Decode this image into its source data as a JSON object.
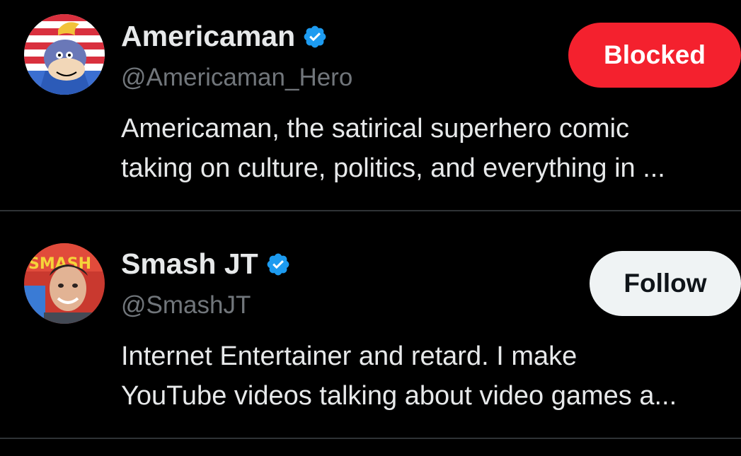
{
  "users": [
    {
      "name": "Americaman",
      "handle": "@Americaman_Hero",
      "verified": true,
      "bio_lines": [
        "Americaman, the satirical superhero comic",
        "taking on culture, politics, and everything in ..."
      ],
      "action_label": "Blocked",
      "action_color": "#f4212e"
    },
    {
      "name": "Smash JT",
      "handle": "@SmashJT",
      "verified": true,
      "bio_lines": [
        "Internet Entertainer and retard. I make",
        "YouTube videos talking about video games a..."
      ],
      "action_label": "Follow",
      "action_color": "#eff3f4"
    }
  ],
  "colors": {
    "background": "#000000",
    "verified_badge": "#1d9bf0",
    "handle_text": "#71767b",
    "divider": "#2f3336"
  },
  "icons": {
    "verified": "verified-badge-icon"
  }
}
